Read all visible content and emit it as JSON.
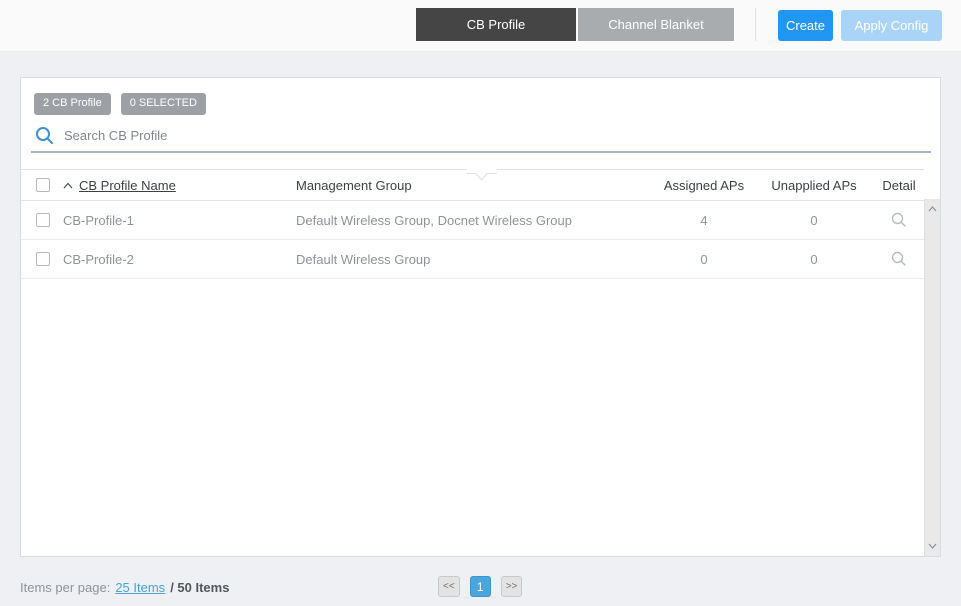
{
  "toolbar": {
    "tabs": [
      {
        "label": "CB Profile",
        "active": true
      },
      {
        "label": "Channel Blanket",
        "active": false
      }
    ],
    "create_button": "Create",
    "apply_config_button": "Apply Config"
  },
  "panel": {
    "count_badge": "2 CB Profile",
    "selected_badge": "0 SELECTED",
    "search_placeholder": "Search CB Profile"
  },
  "table": {
    "header": {
      "name": "CB Profile Name",
      "management_group": "Management Group",
      "assigned_aps": "Assigned APs",
      "unapplied_aps": "Unapplied APs",
      "detail": "Detail"
    },
    "rows": [
      {
        "name": "CB-Profile-1",
        "management_group": "Default Wireless Group, Docnet Wireless Group",
        "assigned_aps": "4",
        "unapplied_aps": "0"
      },
      {
        "name": "CB-Profile-2",
        "management_group": "Default Wireless Group",
        "assigned_aps": "0",
        "unapplied_aps": "0"
      }
    ]
  },
  "footer": {
    "items_per_page_label": "Items per page:",
    "page_size_link": "25 Items",
    "total_text": "/ 50 Items",
    "pagination": {
      "first": "<<",
      "current_page": "1",
      "last": ">>"
    }
  },
  "colors": {
    "accent_blue": "#2196f3",
    "disabled_blue": "#a9d4f7",
    "active_tab_gray": "#454545",
    "inactive_tab_gray": "#a9acaf",
    "active_page_blue": "#4aa6dd",
    "link_blue": "#4aa3d9",
    "badge_gray": "#9da0a4",
    "search_underline": "#a6b4c2"
  }
}
